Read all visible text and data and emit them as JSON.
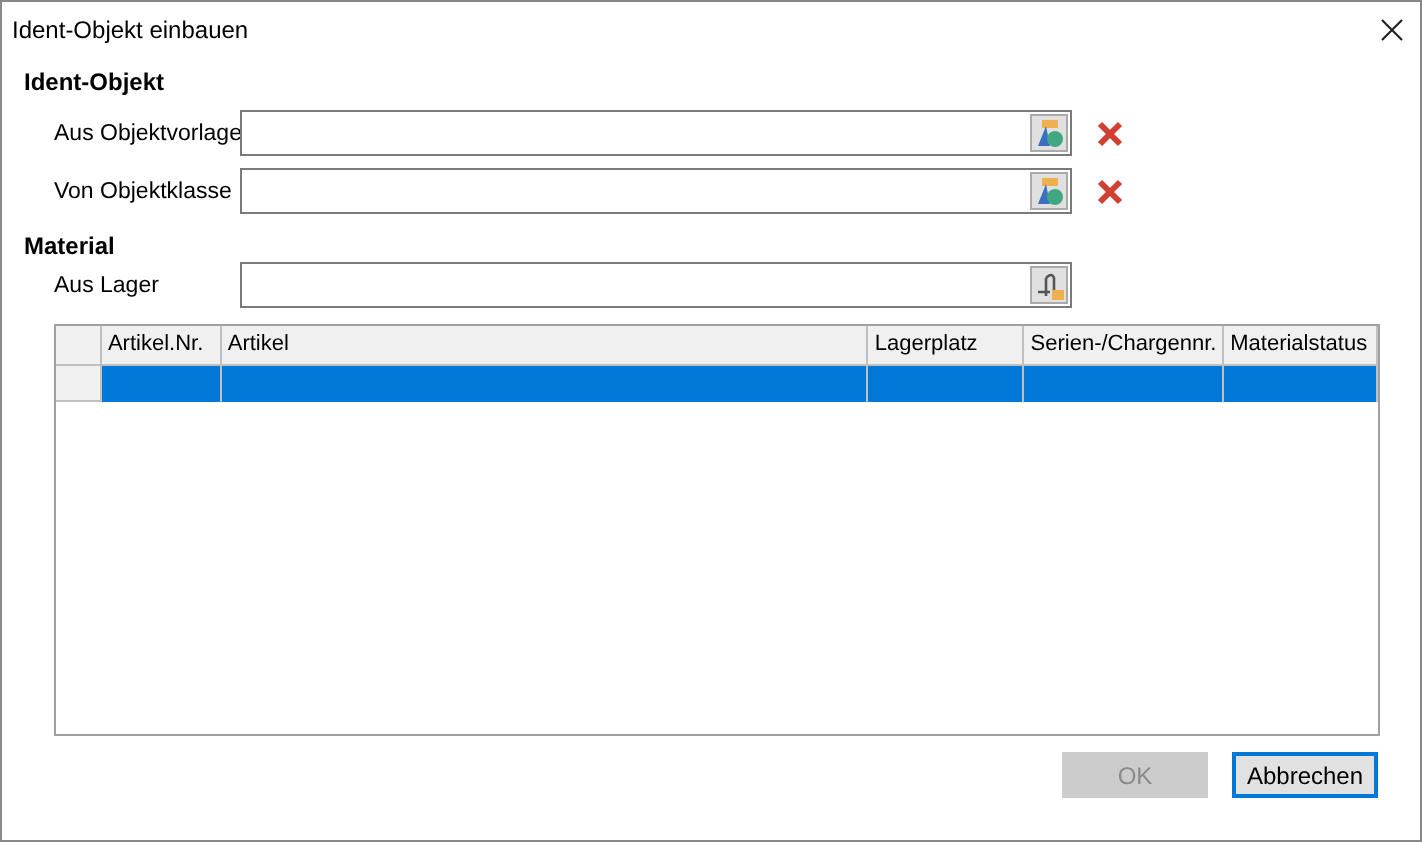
{
  "window": {
    "title": "Ident-Objekt einbauen"
  },
  "sections": [
    {
      "title": "Ident-Objekt",
      "fields": [
        {
          "label": "Aus Objektvorlage",
          "kind": "template",
          "clearable": true
        },
        {
          "label": "Von Objektklasse",
          "kind": "template",
          "clearable": true
        }
      ]
    },
    {
      "title": "Material",
      "fields": [
        {
          "label": "Aus Lager",
          "kind": "stock",
          "clearable": false
        }
      ]
    }
  ],
  "table": {
    "columns": [
      "Artikel.Nr.",
      "Artikel",
      "Lagerplatz",
      "Serien-/Chargennr.",
      "Materialstatus"
    ],
    "rows": [
      {
        "selected": true
      }
    ]
  },
  "buttons": [
    {
      "label": "OK",
      "disabled": true,
      "default": false
    },
    {
      "label": "Abbrechen",
      "disabled": false,
      "default": true
    }
  ]
}
